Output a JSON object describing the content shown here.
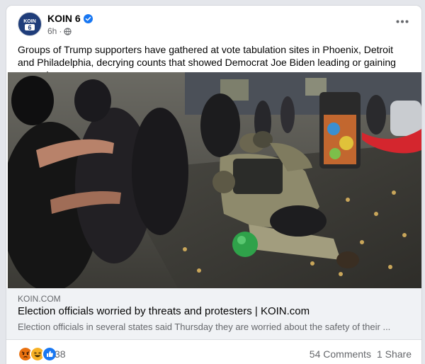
{
  "post": {
    "page_name": "KOIN 6",
    "avatar_text_top": "KOIN",
    "avatar_text_bottom": "6",
    "timestamp": "6h",
    "audience_icon": "globe-icon",
    "caption": "Groups of Trump supporters have gathered at vote tabulation sites in Phoenix, Detroit and Philadelphia, decrying counts that showed Democrat Joe Biden leading or gaining ground."
  },
  "link": {
    "domain": "KOIN.COM",
    "title": "Election officials worried by threats and protesters | KOIN.com",
    "description": "Election officials in several states said Thursday they are worried about the safety of their ..."
  },
  "footer": {
    "reactions": [
      "angry",
      "haha",
      "like"
    ],
    "reaction_count": "38",
    "comments": "54 Comments",
    "shares": "1 Share"
  },
  "colors": {
    "brand": "#1877f2",
    "secondary_text": "#65676b",
    "link_bg": "#f0f2f5",
    "avatar_bg": "#1f3d7a"
  }
}
